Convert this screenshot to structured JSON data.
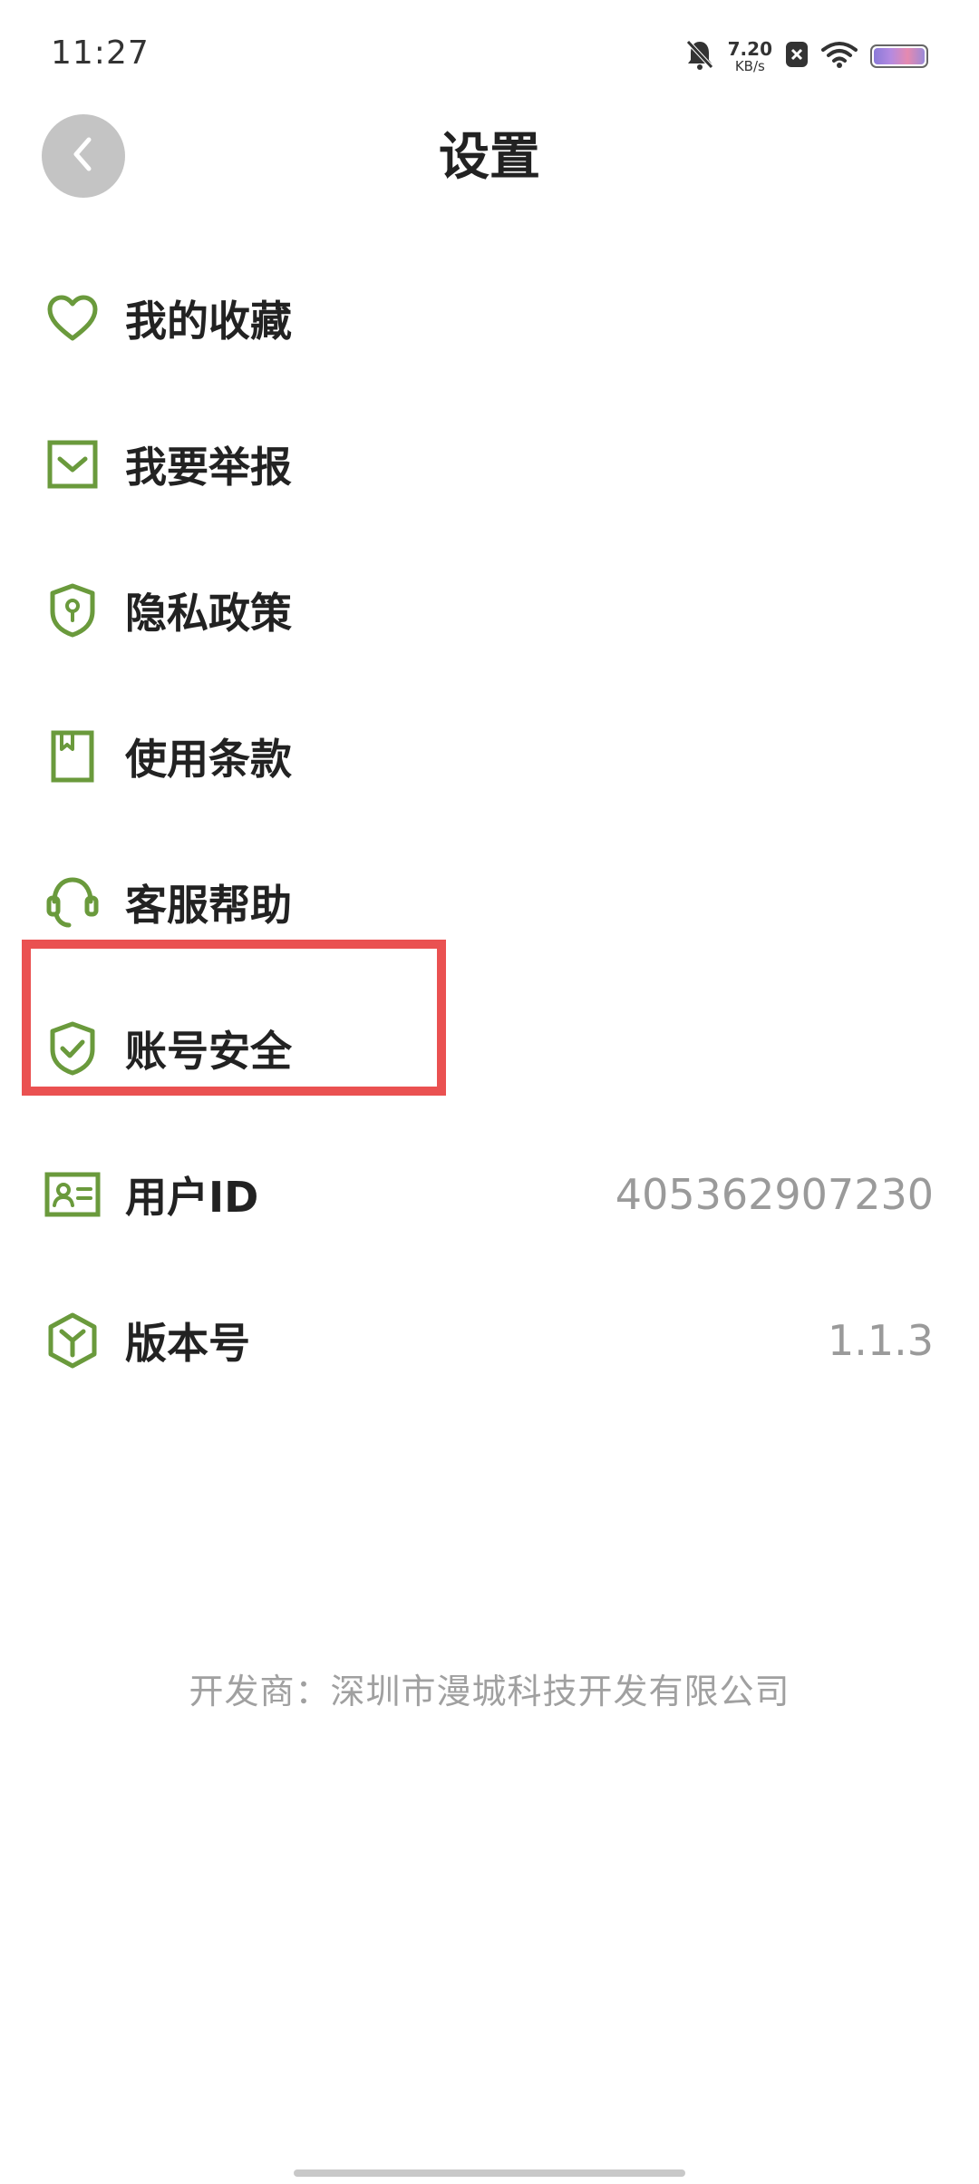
{
  "status_bar": {
    "time": "11:27",
    "net_speed_value": "7.20",
    "net_speed_unit": "KB/s",
    "icons": [
      "bell-muted-icon",
      "close-badge-icon",
      "wifi-icon",
      "battery-icon"
    ]
  },
  "header": {
    "title": "设置",
    "back_icon": "chevron-left-icon"
  },
  "menu": {
    "items": [
      {
        "label": "我的收藏",
        "icon": "heart-icon"
      },
      {
        "label": "我要举报",
        "icon": "report-icon"
      },
      {
        "label": "隐私政策",
        "icon": "shield-key-icon"
      },
      {
        "label": "使用条款",
        "icon": "book-icon"
      },
      {
        "label": "客服帮助",
        "icon": "headset-icon"
      },
      {
        "label": "账号安全",
        "icon": "shield-check-icon"
      },
      {
        "label": "用户ID",
        "icon": "id-card-icon",
        "value": "405362907230"
      },
      {
        "label": "版本号",
        "icon": "cube-icon",
        "value": "1.1.3"
      }
    ]
  },
  "footer": {
    "developer": "开发商：深圳市漫城科技开发有限公司"
  },
  "colors": {
    "icon_green": "#6a9a3c",
    "highlight_red": "#ea5151",
    "back_button_gray": "#c4c4c4",
    "value_gray": "#9a9a9a"
  }
}
